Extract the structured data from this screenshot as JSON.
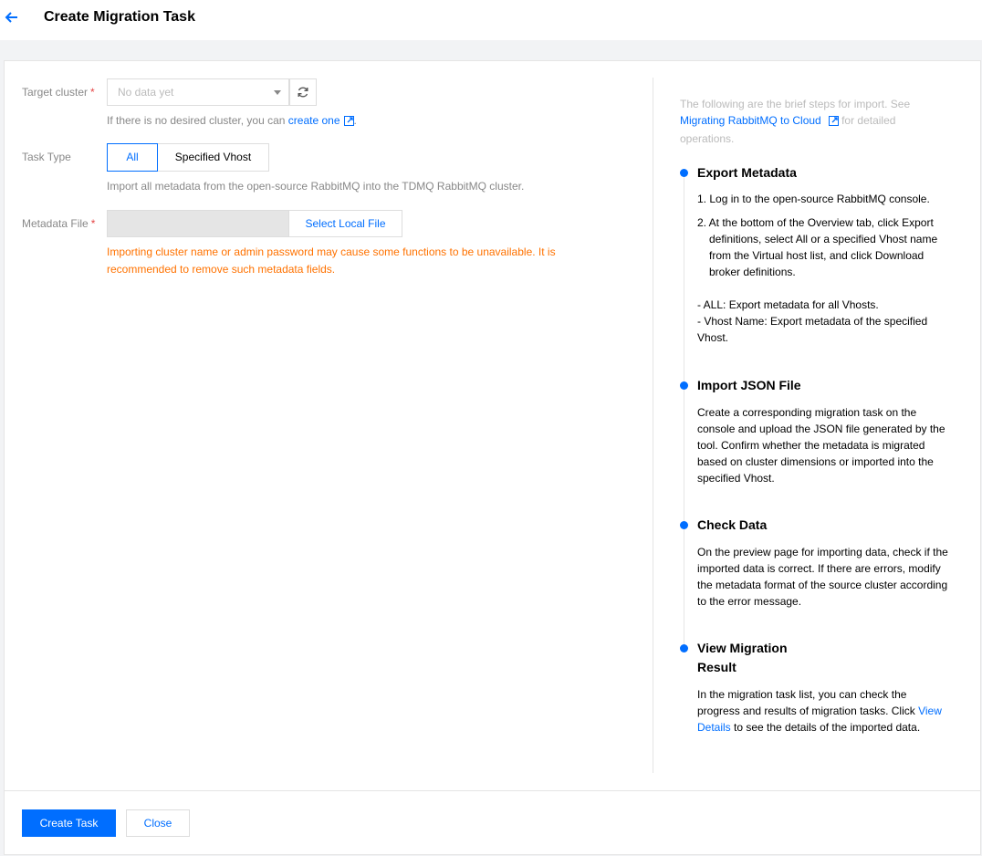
{
  "header": {
    "title": "Create Migration Task",
    "back_icon": "arrow-left-icon"
  },
  "form": {
    "target_cluster": {
      "label": "Target cluster",
      "required_mark": "*",
      "placeholder": "No data yet",
      "hint_prefix": "If there is no desired cluster, you can ",
      "hint_link": "create one",
      "hint_suffix": "."
    },
    "task_type": {
      "label": "Task Type",
      "options": [
        "All",
        "Specified Vhost"
      ],
      "selected": "All",
      "hint": "Import all metadata from the open-source RabbitMQ into the TDMQ RabbitMQ cluster."
    },
    "metadata_file": {
      "label": "Metadata File",
      "required_mark": "*",
      "button": "Select Local File",
      "warning": "Importing cluster name or admin password may cause some functions to be unavailable. It is recommended to remove such metadata fields."
    }
  },
  "steps_panel": {
    "intro_prefix": "The following are the brief steps for import. See ",
    "intro_link": "Migrating RabbitMQ to Cloud",
    "intro_suffix": " for detailed operations.",
    "steps": [
      {
        "title": "Export Metadata",
        "items": [
          "1. Log in to the open-source RabbitMQ console.",
          "2. At the bottom of the Overview tab, click Export definitions, select All or a specified Vhost name from the Virtual host list, and click Download broker definitions."
        ],
        "notes": [
          "- ALL: Export metadata for all Vhosts.",
          "- Vhost Name: Export metadata of the specified Vhost."
        ]
      },
      {
        "title": "Import JSON File",
        "body": "Create a corresponding migration task on the console and upload the JSON file generated by the tool. Confirm whether the metadata is migrated based on cluster dimensions or imported into the specified Vhost."
      },
      {
        "title": "Check Data",
        "body": "On the preview page for importing data, check if the imported data is correct. If there are errors, modify the metadata format of the source cluster according to the error message."
      },
      {
        "title_line1": "View Migration",
        "title_line2": "Result",
        "body_prefix": "In the migration task list, you can check the progress and results of migration tasks. Click ",
        "body_link": "View Details",
        "body_suffix": " to see the details of the imported data."
      }
    ]
  },
  "footer": {
    "primary_button": "Create Task",
    "secondary_button": "Close"
  },
  "colors": {
    "accent": "#006eff",
    "warning": "#ff7200",
    "required": "#e54545"
  }
}
